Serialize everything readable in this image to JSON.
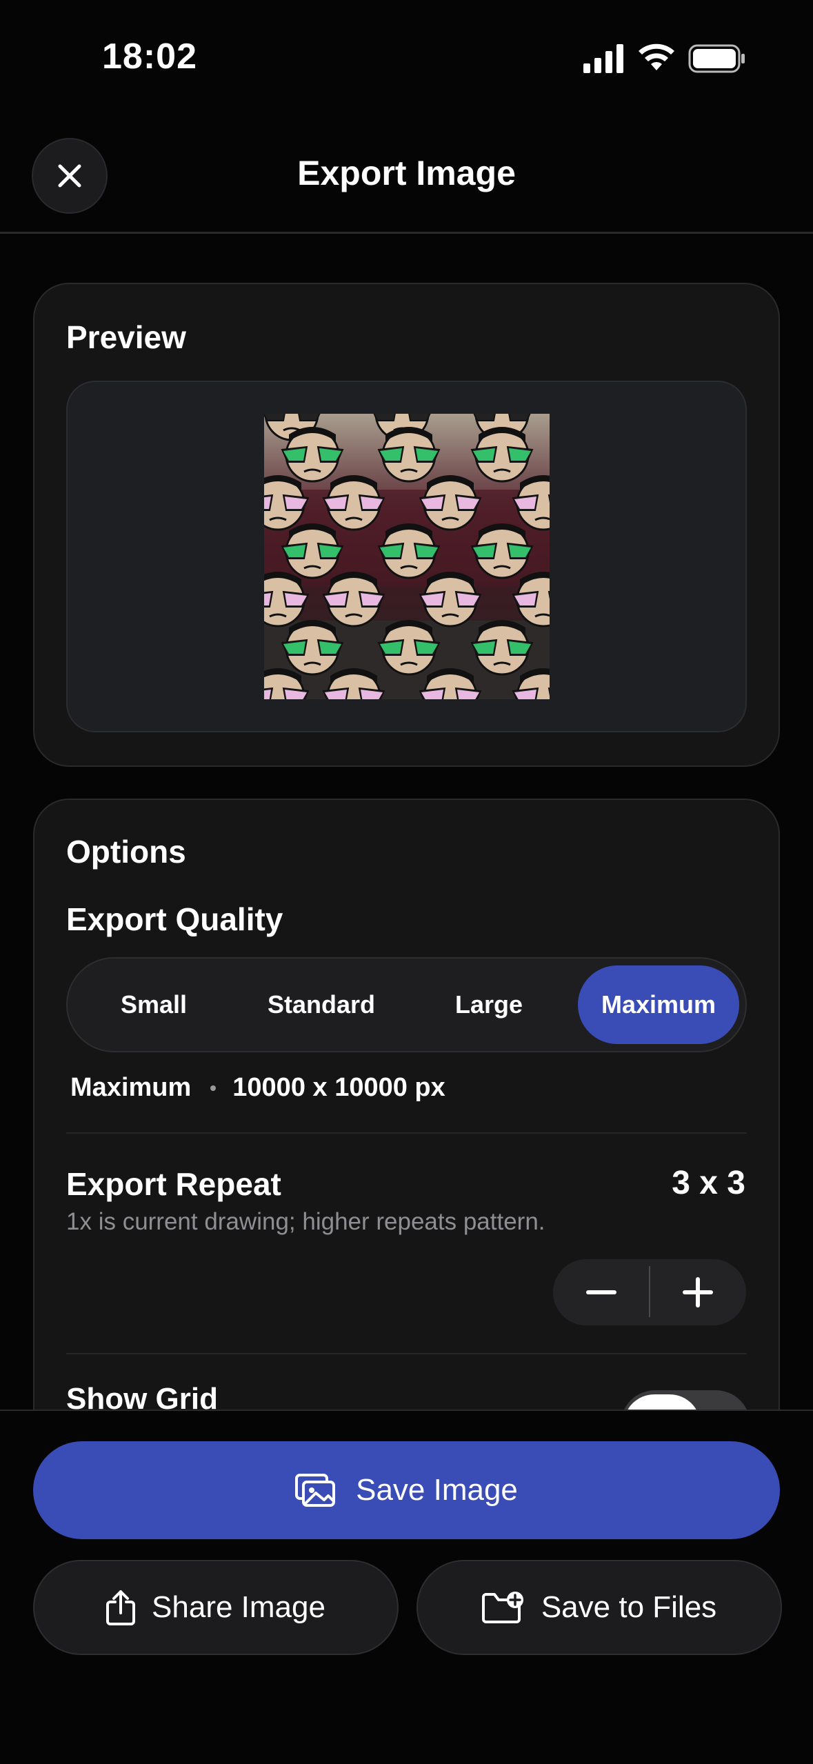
{
  "status_bar": {
    "time": "18:02",
    "icons": [
      "cellular-signal-icon",
      "wifi-icon",
      "battery-icon"
    ]
  },
  "header": {
    "title": "Export Image",
    "close_icon": "close-icon"
  },
  "preview": {
    "title": "Preview"
  },
  "options": {
    "title": "Options",
    "quality": {
      "title": "Export Quality",
      "options": [
        "Small",
        "Standard",
        "Large",
        "Maximum"
      ],
      "selected": "Maximum",
      "info_name": "Maximum",
      "info_size": "10000 x 10000 px"
    },
    "repeat": {
      "title": "Export Repeat",
      "value": "3 x 3",
      "hint": "1x is current drawing; higher repeats pattern."
    },
    "grid": {
      "label": "Show Grid",
      "enabled": true
    }
  },
  "actions": {
    "save": "Save Image",
    "share": "Share Image",
    "files": "Save to Files"
  },
  "colors": {
    "accent": "#3a4db6",
    "background": "#050505",
    "card": "#151516"
  }
}
